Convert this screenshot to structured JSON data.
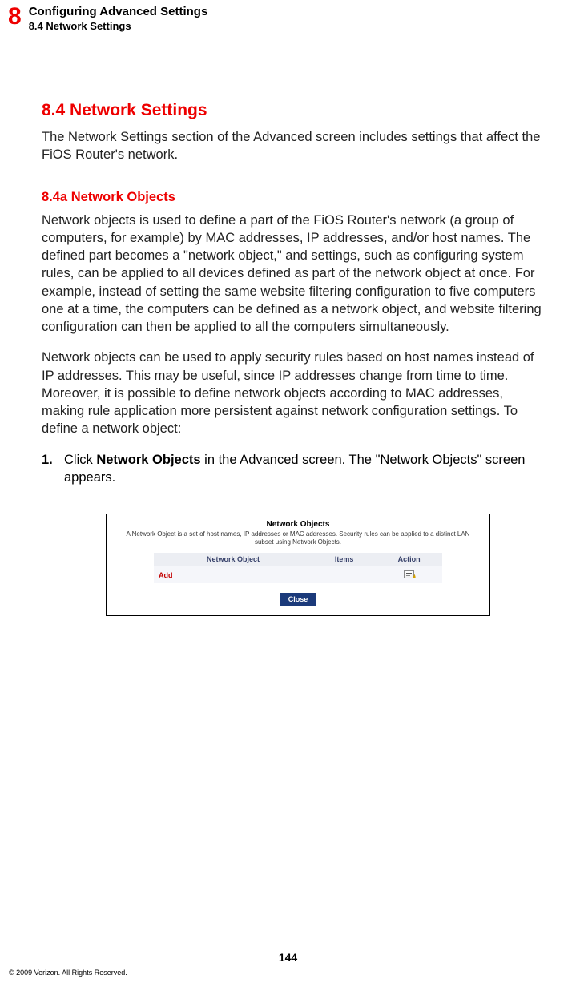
{
  "header": {
    "chapter_number": "8",
    "title": "Configuring Advanced Settings",
    "subtitle": "8.4  Network Settings"
  },
  "section": {
    "heading": "8.4  Network Settings",
    "intro": "The Network Settings section of the Advanced screen includes settings that affect the FiOS Router's network."
  },
  "subsection": {
    "heading": "8.4a  Network Objects",
    "para1": "Network objects is used to define a part of the FiOS Router's network (a group of computers, for example) by MAC addresses, IP addresses, and/or host names. The defined part becomes a \"network object,\" and settings, such as configuring system rules, can be applied to all devices defined as part of the network object at once. For example, instead of setting the same website filtering configuration to five computers one at a time, the computers can be defined as a network object, and website filtering configuration can then be applied to all the computers simultaneously.",
    "para2": "Network objects can be used to apply security rules based on host names instead of IP addresses. This may be useful, since IP addresses change from time to time. Moreover, it is possible to define network objects according to MAC addresses, making rule application more persistent against network configuration settings.  To define a network object:"
  },
  "step": {
    "number": "1.",
    "pre": "Click ",
    "bold": "Network Objects",
    "post": " in the Advanced screen. The \"Network Objects\" screen appears."
  },
  "screenshot": {
    "title": "Network Objects",
    "description": "A Network Object is a set of host names, IP addresses or MAC addresses. Security rules can be applied to a distinct LAN subset using Network Objects.",
    "columns": {
      "c1": "Network Object",
      "c2": "Items",
      "c3": "Action"
    },
    "add_label": "Add",
    "close_label": "Close"
  },
  "footer": {
    "page_number": "144",
    "copyright": "© 2009 Verizon. All Rights Reserved."
  }
}
